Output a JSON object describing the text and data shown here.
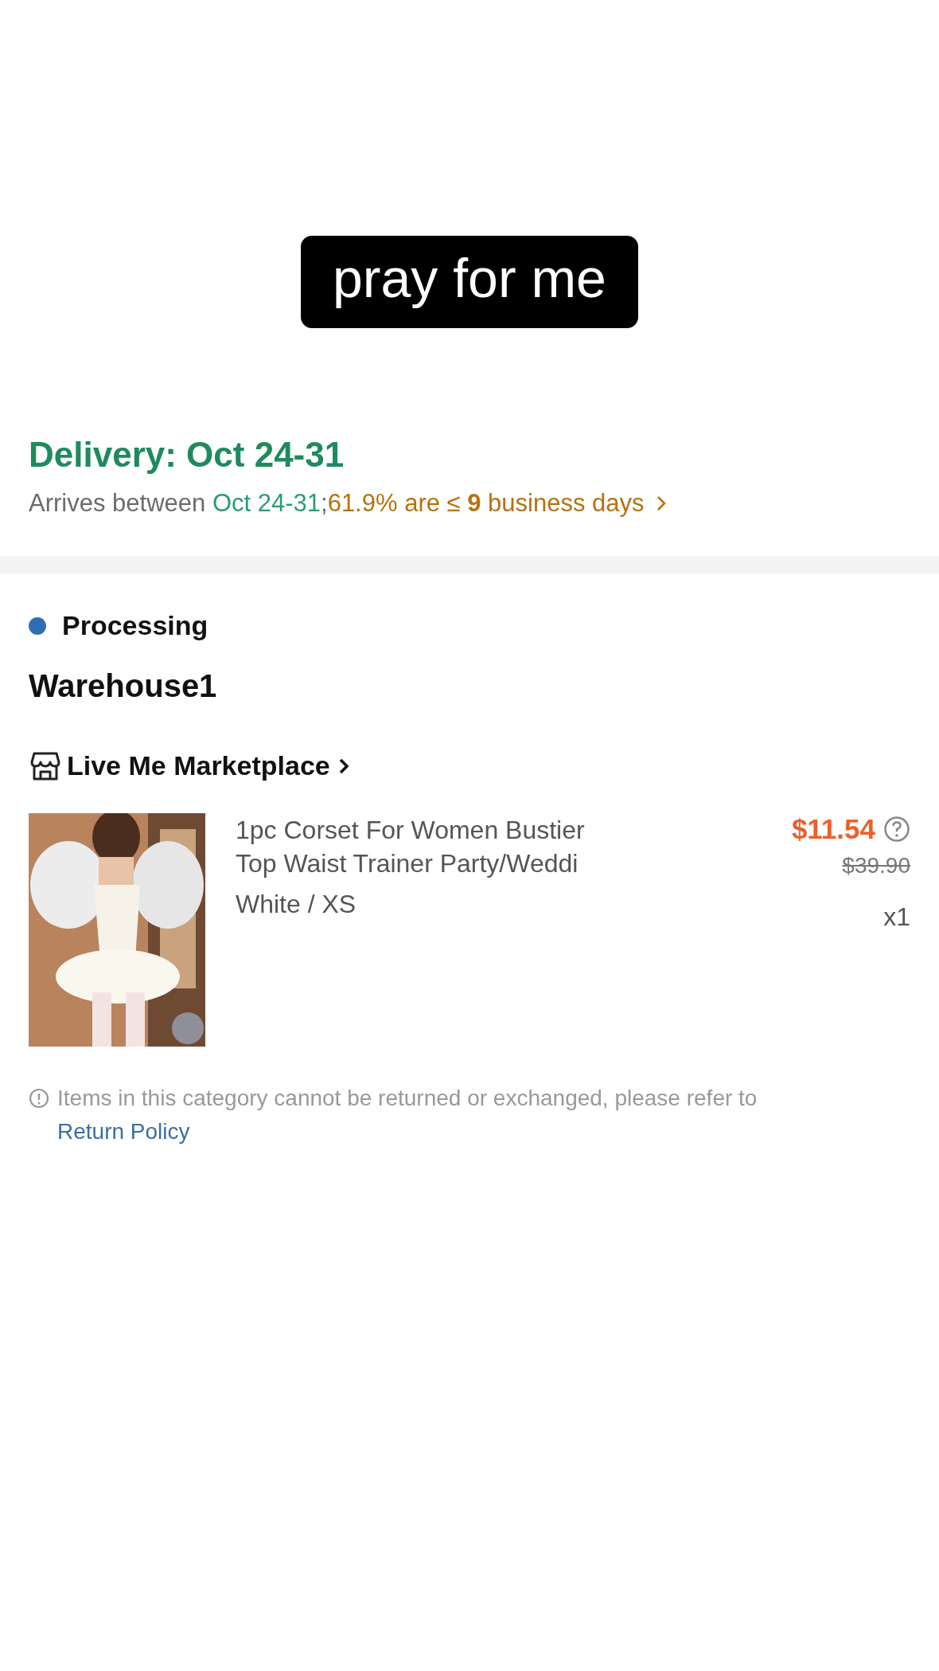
{
  "caption": "pray for me",
  "delivery": {
    "title": "Delivery: Oct 24-31",
    "summary": [
      {
        "kind": "plain",
        "text": "Arrives between "
      },
      {
        "kind": "date",
        "text": "Oct 24-31"
      },
      {
        "kind": "plain",
        "text": ";"
      },
      {
        "kind": "stat",
        "text": "61.9% are ≤ **9** business days"
      }
    ]
  },
  "package": {
    "status": {
      "label": "Processing",
      "color": "#2f6db5"
    },
    "warehouse": "Warehouse1",
    "store": {
      "name": "Live Me Marketplace"
    },
    "item": {
      "kind": "picture",
      "title": "1pc Corset For Women Bustier Top Waist Trainer Party/Weddi",
      "variant": "White / XS",
      "price": "$11.54",
      "original_price": "$39.90",
      "quantity": "x1"
    }
  },
  "notice": {
    "text": "Items in this category cannot be returned or exchanged, please refer to",
    "link": "Return Policy"
  }
}
